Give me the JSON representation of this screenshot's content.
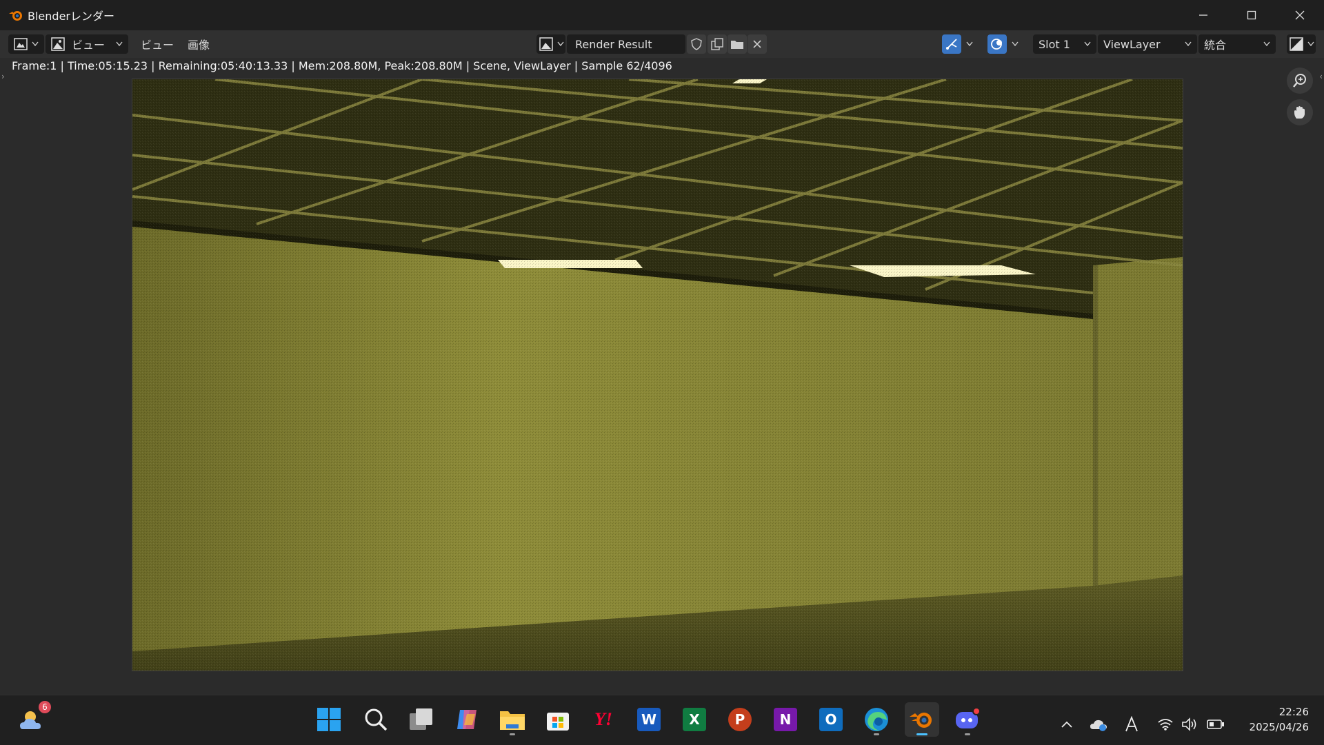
{
  "window": {
    "title": "Blenderレンダー"
  },
  "header": {
    "editor_type_icon": "image-editor-icon",
    "view_menu_dropdown": "ビュー",
    "view_menu": "ビュー",
    "image_menu": "画像",
    "image_name": "Render Result",
    "slot": "Slot 1",
    "view_layer": "ViewLayer",
    "render_pass": "統合"
  },
  "status": {
    "text": "Frame:1 | Time:05:15.23 | Remaining:05:40:13.33 | Mem:208.80M, Peak:208.80M | Scene, ViewLayer | Sample 62/4096"
  },
  "render": {
    "description_colors": {
      "ceiling": "#2a2a10",
      "wall": "#8c8a35",
      "floor": "#4f4d1e",
      "light": "#fbf6c8"
    }
  },
  "taskbar": {
    "weather_badge": "6",
    "apps": [
      {
        "name": "start-icon"
      },
      {
        "name": "search-icon"
      },
      {
        "name": "task-view-icon"
      },
      {
        "name": "copilot-icon"
      },
      {
        "name": "file-explorer-icon"
      },
      {
        "name": "store-icon"
      },
      {
        "name": "yahoo-icon",
        "label": "Y!"
      },
      {
        "name": "word-icon",
        "label": "W"
      },
      {
        "name": "excel-icon",
        "label": "X"
      },
      {
        "name": "powerpoint-icon",
        "label": "P"
      },
      {
        "name": "onenote-icon",
        "label": "N"
      },
      {
        "name": "outlook-icon",
        "label": "O"
      },
      {
        "name": "edge-icon"
      },
      {
        "name": "blender-icon"
      },
      {
        "name": "discord-icon"
      }
    ],
    "time": "22:26",
    "date": "2025/04/26"
  }
}
